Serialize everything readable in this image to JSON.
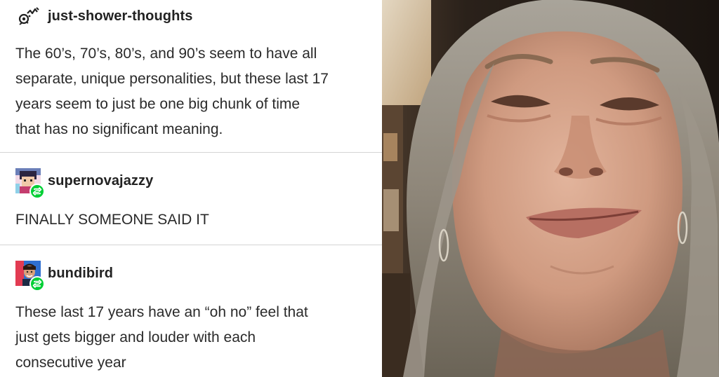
{
  "posts": [
    {
      "username": "just-shower-thoughts",
      "avatar_icon": "shooting-star-doodle-icon",
      "reblogged": false,
      "lines": [
        "The 60’s, 70’s, 80’s, and 90’s seem to have all",
        "separate, unique personalities, but these last 17",
        "years seem to just be one big chunk of time",
        "that has no significant meaning."
      ]
    },
    {
      "username": "supernovajazzy",
      "avatar_icon": "pixel-character-avatar-icon",
      "reblogged": true,
      "reblog_icon": "reblog-icon",
      "lines": [
        "FINALLY SOMEONE SAID IT"
      ]
    },
    {
      "username": "bundibird",
      "avatar_icon": "man-portrait-avatar-icon",
      "reblogged": true,
      "reblog_icon": "reblog-icon",
      "lines": [
        "These last 17 years have an “oh no” feel that",
        "just gets bigger and louder with each",
        "consecutive year"
      ]
    }
  ],
  "colors": {
    "text": "#2a2a2a",
    "divider": "#d4d4d4",
    "reblog_badge": "#00cf35",
    "background": "#ffffff"
  },
  "photo": {
    "description_icon": "crying-woman-photo"
  }
}
